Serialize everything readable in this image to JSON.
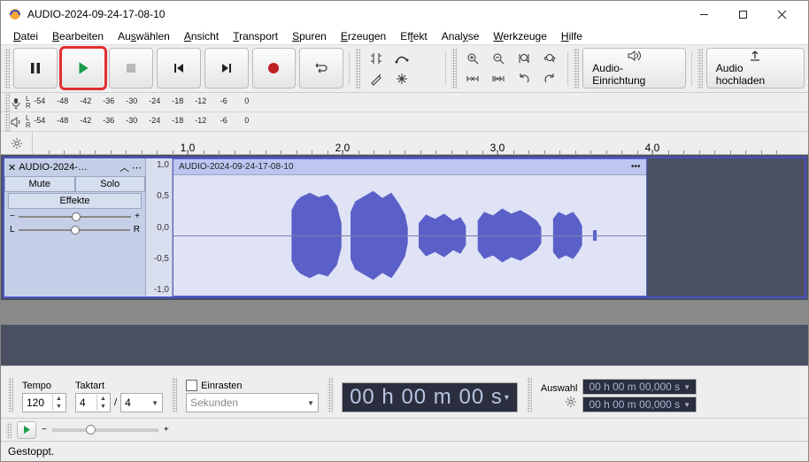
{
  "window": {
    "title": "AUDIO-2024-09-24-17-08-10"
  },
  "menu": {
    "items": [
      {
        "label": "Datei",
        "u": 0
      },
      {
        "label": "Bearbeiten",
        "u": 0
      },
      {
        "label": "Auswählen",
        "u": 2
      },
      {
        "label": "Ansicht",
        "u": 0
      },
      {
        "label": "Transport",
        "u": 0
      },
      {
        "label": "Spuren",
        "u": 0
      },
      {
        "label": "Erzeugen",
        "u": 0
      },
      {
        "label": "Effekt",
        "u": 2
      },
      {
        "label": "Analyse",
        "u": 4
      },
      {
        "label": "Werkzeuge",
        "u": 0
      },
      {
        "label": "Hilfe",
        "u": 0
      }
    ]
  },
  "toolbar": {
    "audio_setup": "Audio-Einrichtung",
    "audio_upload": "Audio hochladen"
  },
  "meter": {
    "ticks": [
      "-54",
      "-48",
      "-42",
      "-36",
      "-30",
      "-24",
      "-18",
      "-12",
      "-6",
      "0"
    ],
    "lr": [
      "L",
      "R"
    ]
  },
  "timeline": {
    "majors": [
      "1,0",
      "2,0",
      "3,0",
      "4,0"
    ]
  },
  "track": {
    "panel_title": "AUDIO-2024-…",
    "mute": "Mute",
    "solo": "Solo",
    "effects": "Effekte",
    "gain_minus": "−",
    "gain_plus": "+",
    "pan_l": "L",
    "pan_r": "R",
    "clip_name": "AUDIO-2024-09-24-17-08-10",
    "y_labels": [
      "1,0",
      "0,5",
      "0,0",
      "-0,5",
      "-1,0"
    ],
    "clip_dots": "•••"
  },
  "bottom": {
    "tempo_label": "Tempo",
    "tempo_value": "120",
    "takt_label": "Taktart",
    "takt_num": "4",
    "takt_den": "4",
    "slash": "/",
    "snap_label": "Einrasten",
    "snap_combo": "Sekunden",
    "time_main": "00 h 00 m 00 s",
    "sel_label": "Auswahl",
    "sel_start": "00 h 00 m 00,000 s",
    "sel_end": "00 h 00 m 00,000 s"
  },
  "status": {
    "text": "Gestoppt."
  }
}
